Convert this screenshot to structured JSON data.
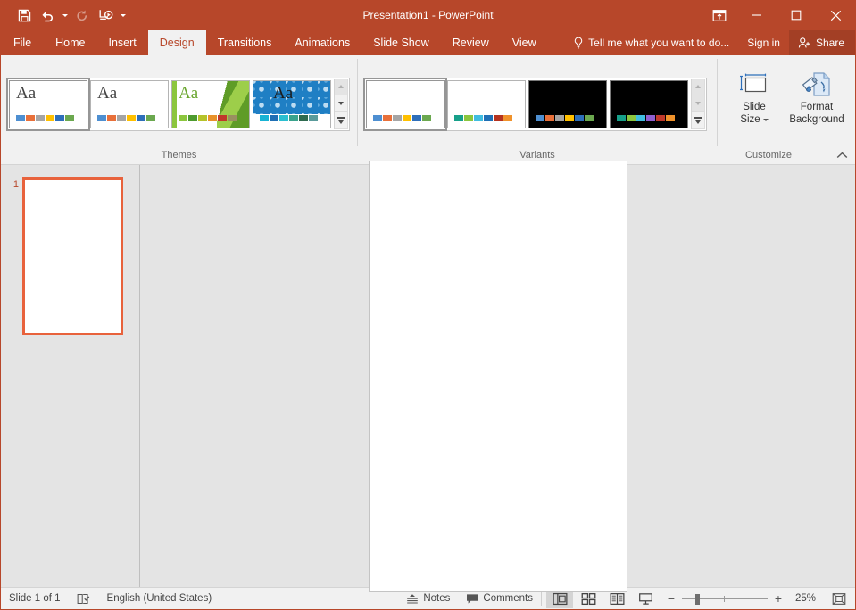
{
  "window": {
    "title": "Presentation1 - PowerPoint",
    "accent_color": "#b7472a",
    "share_bg": "#a33f25"
  },
  "quick_access": {
    "items": [
      {
        "name": "save",
        "tooltip": "Save"
      },
      {
        "name": "undo",
        "tooltip": "Undo"
      },
      {
        "name": "redo",
        "tooltip": "Redo",
        "disabled": true
      },
      {
        "name": "start-from-beginning",
        "tooltip": "Start From Beginning"
      },
      {
        "name": "customize",
        "tooltip": "Customize Quick Access Toolbar"
      }
    ]
  },
  "window_controls": {
    "ribbon_display": "Ribbon Display Options",
    "minimize": "Minimize",
    "maximize": "Maximize",
    "close": "Close"
  },
  "tabs": [
    {
      "label": "File",
      "active": false
    },
    {
      "label": "Home",
      "active": false
    },
    {
      "label": "Insert",
      "active": false
    },
    {
      "label": "Design",
      "active": true
    },
    {
      "label": "Transitions",
      "active": false
    },
    {
      "label": "Animations",
      "active": false
    },
    {
      "label": "Slide Show",
      "active": false
    },
    {
      "label": "Review",
      "active": false
    },
    {
      "label": "View",
      "active": false
    }
  ],
  "tab_right": {
    "tell_me": "Tell me what you want to do...",
    "sign_in": "Sign in",
    "share": "Share"
  },
  "ribbon": {
    "groups": [
      {
        "label": "Themes"
      },
      {
        "label": "Variants"
      },
      {
        "label": "Customize"
      }
    ],
    "themes": {
      "label": "Themes",
      "items": [
        {
          "name": "office-theme",
          "aa": "Aa",
          "selected": true,
          "style": "plain",
          "swatches": [
            "#4e8fd1",
            "#e8703a",
            "#a5a5a5",
            "#ffc000",
            "#2e6fba",
            "#6ba84f"
          ]
        },
        {
          "name": "office-theme-2",
          "aa": "Aa",
          "selected": false,
          "style": "plain",
          "swatches": [
            "#4e8fd1",
            "#e8703a",
            "#a5a5a5",
            "#ffc000",
            "#2e6fba",
            "#6ba84f"
          ]
        },
        {
          "name": "facet-theme",
          "aa": "Aa",
          "selected": false,
          "style": "green",
          "swatches": [
            "#8cc63e",
            "#4e9b2f",
            "#b5c32a",
            "#e8922a",
            "#c0392b",
            "#9a9060"
          ]
        },
        {
          "name": "berlin-theme",
          "aa": "Aa",
          "selected": false,
          "style": "pattern",
          "swatches": [
            "#17b3d4",
            "#1f6fb5",
            "#2bbfd0",
            "#3aa38c",
            "#2f6b4f",
            "#5a9b9b"
          ]
        }
      ],
      "scroll": {
        "up": "Scroll Up",
        "down": "Scroll Down",
        "more": "More"
      }
    },
    "variants": {
      "label": "Variants",
      "items": [
        {
          "name": "variant-1",
          "selected": true,
          "dark": false,
          "swatches": [
            "#4e8fd1",
            "#e8703a",
            "#a5a5a5",
            "#ffc000",
            "#2e6fba",
            "#6ba84f"
          ]
        },
        {
          "name": "variant-2",
          "selected": false,
          "dark": false,
          "swatches": [
            "#17a08a",
            "#8cc63e",
            "#40bde0",
            "#1f6fb5",
            "#b5321f",
            "#f0922b"
          ]
        },
        {
          "name": "variant-3",
          "selected": false,
          "dark": true,
          "swatches": [
            "#4e8fd1",
            "#e8703a",
            "#a5a5a5",
            "#ffc000",
            "#2e6fba",
            "#6ba84f"
          ]
        },
        {
          "name": "variant-4",
          "selected": false,
          "dark": true,
          "swatches": [
            "#17a08a",
            "#8cc63e",
            "#40bde0",
            "#8f5fd0",
            "#c0392b",
            "#f0922b"
          ]
        }
      ],
      "scroll": {
        "up": "Scroll Up",
        "down": "Scroll Down",
        "more": "More"
      }
    },
    "customize": {
      "label": "Customize",
      "slide_size_line1": "Slide",
      "slide_size_line2": "Size",
      "format_background_line1": "Format",
      "format_background_line2": "Background"
    },
    "collapse": "Collapse the Ribbon"
  },
  "thumbnails": {
    "slides": [
      {
        "number": "1",
        "selected": true
      }
    ]
  },
  "status_bar": {
    "slide_count": "Slide 1 of 1",
    "spellcheck": "Spelling and Grammar Check",
    "language": "English (United States)",
    "notes": "Notes",
    "comments": "Comments",
    "views": [
      {
        "name": "normal-view",
        "label": "Normal",
        "active": true
      },
      {
        "name": "slide-sorter-view",
        "label": "Slide Sorter",
        "active": false
      },
      {
        "name": "reading-view",
        "label": "Reading View",
        "active": false
      },
      {
        "name": "slide-show-view",
        "label": "Slide Show",
        "active": false
      }
    ],
    "zoom_out": "−",
    "zoom_in": "+",
    "zoom_level": "25%",
    "fit_to_window": "Fit slide to current window"
  }
}
